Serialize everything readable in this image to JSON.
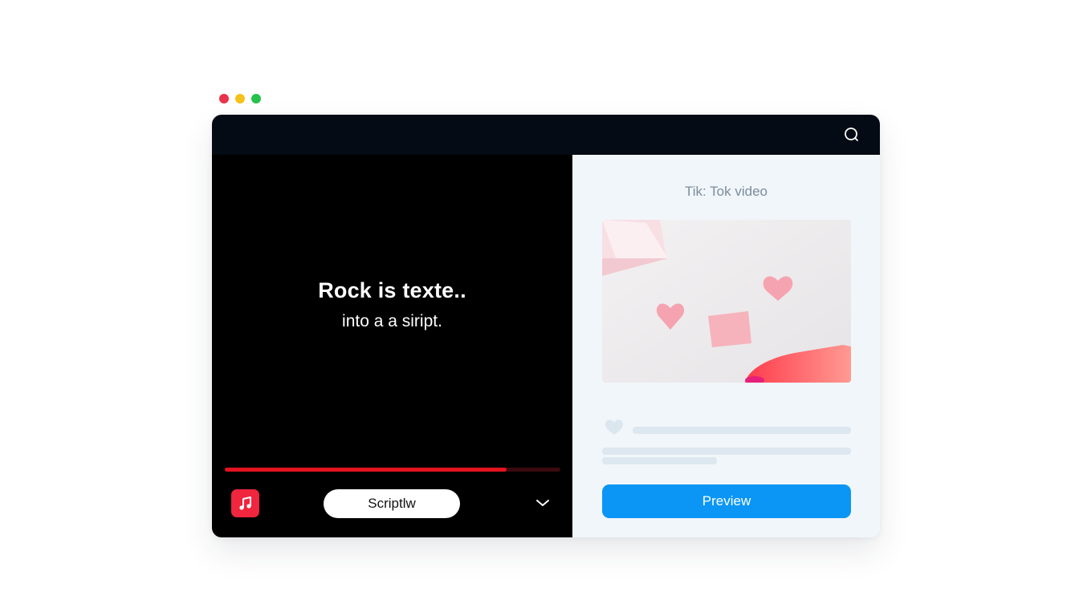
{
  "window": {
    "controls": [
      "close",
      "minimize",
      "maximize"
    ],
    "colors": {
      "close": "#e8334a",
      "minimize": "#f5c21b",
      "maximize": "#27c24c"
    }
  },
  "toolbar": {
    "search_icon": "search-icon"
  },
  "editor": {
    "headline": "Rock is texte..",
    "subline": "into a a siript.",
    "progress": 0.84,
    "music_icon": "music-note-icon",
    "script_button_label": "Scriptlw",
    "expand_icon": "chevron-down-icon"
  },
  "preview_panel": {
    "title": "Tik: Tok video",
    "thumbnail": "pink-hearts-image",
    "like_icon": "heart-icon",
    "preview_button_label": "Preview",
    "accent_color": "#0b96f5"
  }
}
